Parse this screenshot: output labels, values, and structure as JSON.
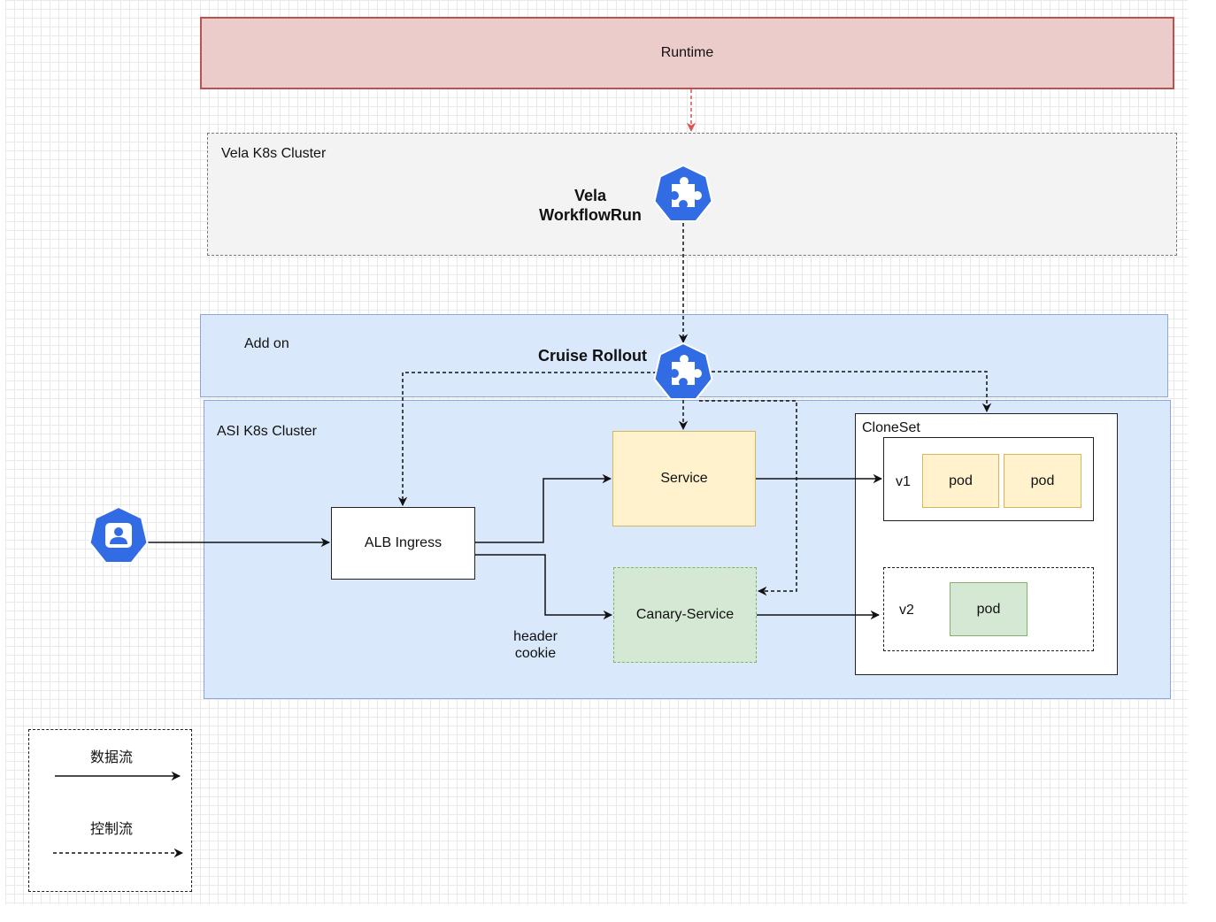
{
  "nodes": {
    "runtime": "Runtime",
    "vela_cluster": "Vela K8s Cluster",
    "vela_workflowrun": "Vela\nWorkflowRun",
    "addon": "Add on",
    "cruise_rollout": "Cruise Rollout",
    "asi_cluster": "ASI K8s Cluster",
    "alb_ingress": "ALB Ingress",
    "service": "Service",
    "canary_service": "Canary-Service",
    "header_cookie": "header\ncookie",
    "cloneset": "CloneSet",
    "v1": "v1",
    "v2": "v2",
    "pod_v1_a": "pod",
    "pod_v1_b": "pod",
    "pod_v2": "pod"
  },
  "legend": {
    "data_flow": "数据流",
    "control_flow": "控制流"
  },
  "icons": {
    "workflow": "kubernetes-crd-puzzle-icon",
    "rollout": "kubernetes-crd-puzzle-icon",
    "user": "kubernetes-user-icon"
  },
  "colors": {
    "runtime_fill": "#eccbcb",
    "runtime_stroke": "#b85450",
    "addon_fill": "#dae8fc",
    "addon_stroke": "#8aa7d6",
    "service_fill": "#fff2cc",
    "service_stroke": "#d6b656",
    "canary_fill": "#d5e8d4",
    "canary_stroke": "#82b366",
    "k8s_blue": "#326ce5"
  }
}
